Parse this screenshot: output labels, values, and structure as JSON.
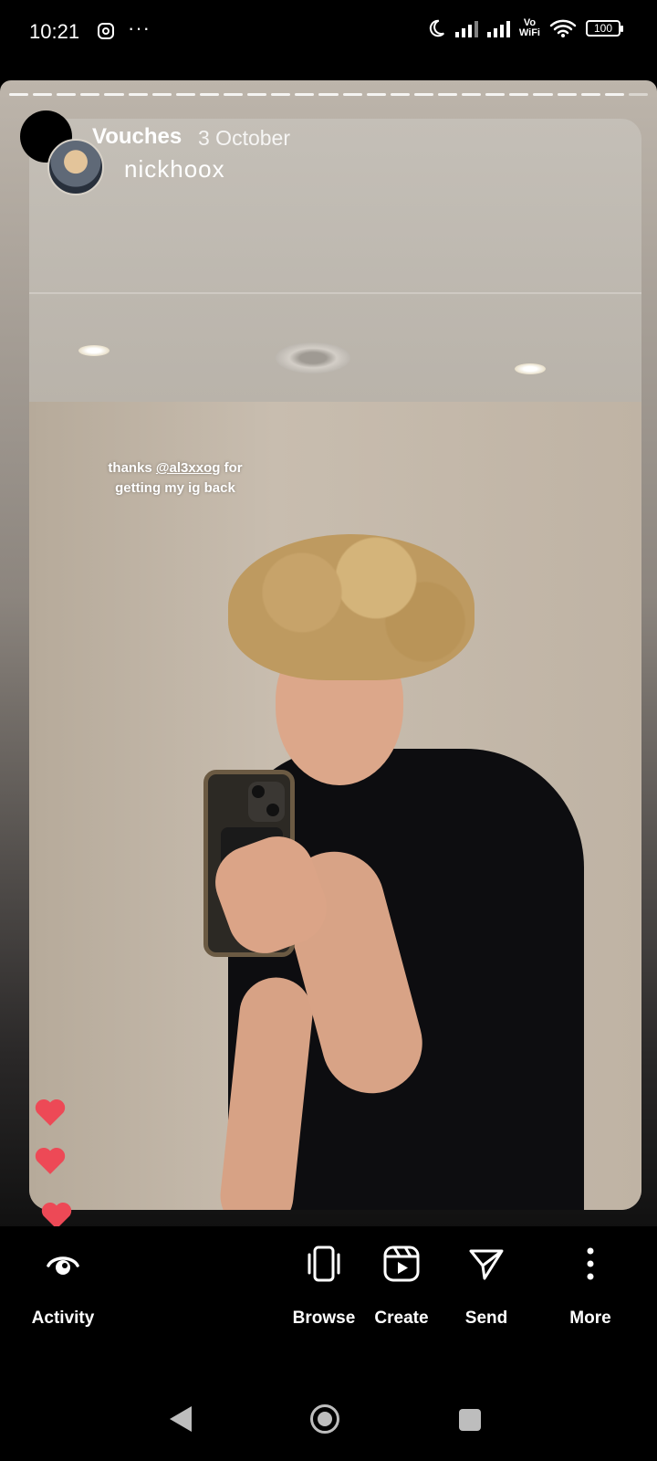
{
  "status_bar": {
    "time": "10:21",
    "notification_icons": [
      "instagram-icon",
      "more-dots-icon"
    ],
    "more": "···",
    "vowifi_top": "Vo",
    "vowifi_bottom": "WiFi",
    "battery": "100"
  },
  "story": {
    "title": "Vouches",
    "date": "3 October",
    "username": "nickhoox",
    "caption_pre": "thanks ",
    "caption_mention": "@al3xxog",
    "caption_post": " for getting my ig back",
    "reactions": [
      "heart",
      "heart",
      "heart"
    ],
    "reaction_color": "#ed4956"
  },
  "actions": [
    {
      "label": "Activity",
      "icon": "activity-eye-icon"
    },
    {
      "label": "Browse",
      "icon": "browse-icon"
    },
    {
      "label": "Create",
      "icon": "create-reels-icon"
    },
    {
      "label": "Send",
      "icon": "send-icon"
    },
    {
      "label": "More",
      "icon": "more-vertical-icon"
    }
  ]
}
